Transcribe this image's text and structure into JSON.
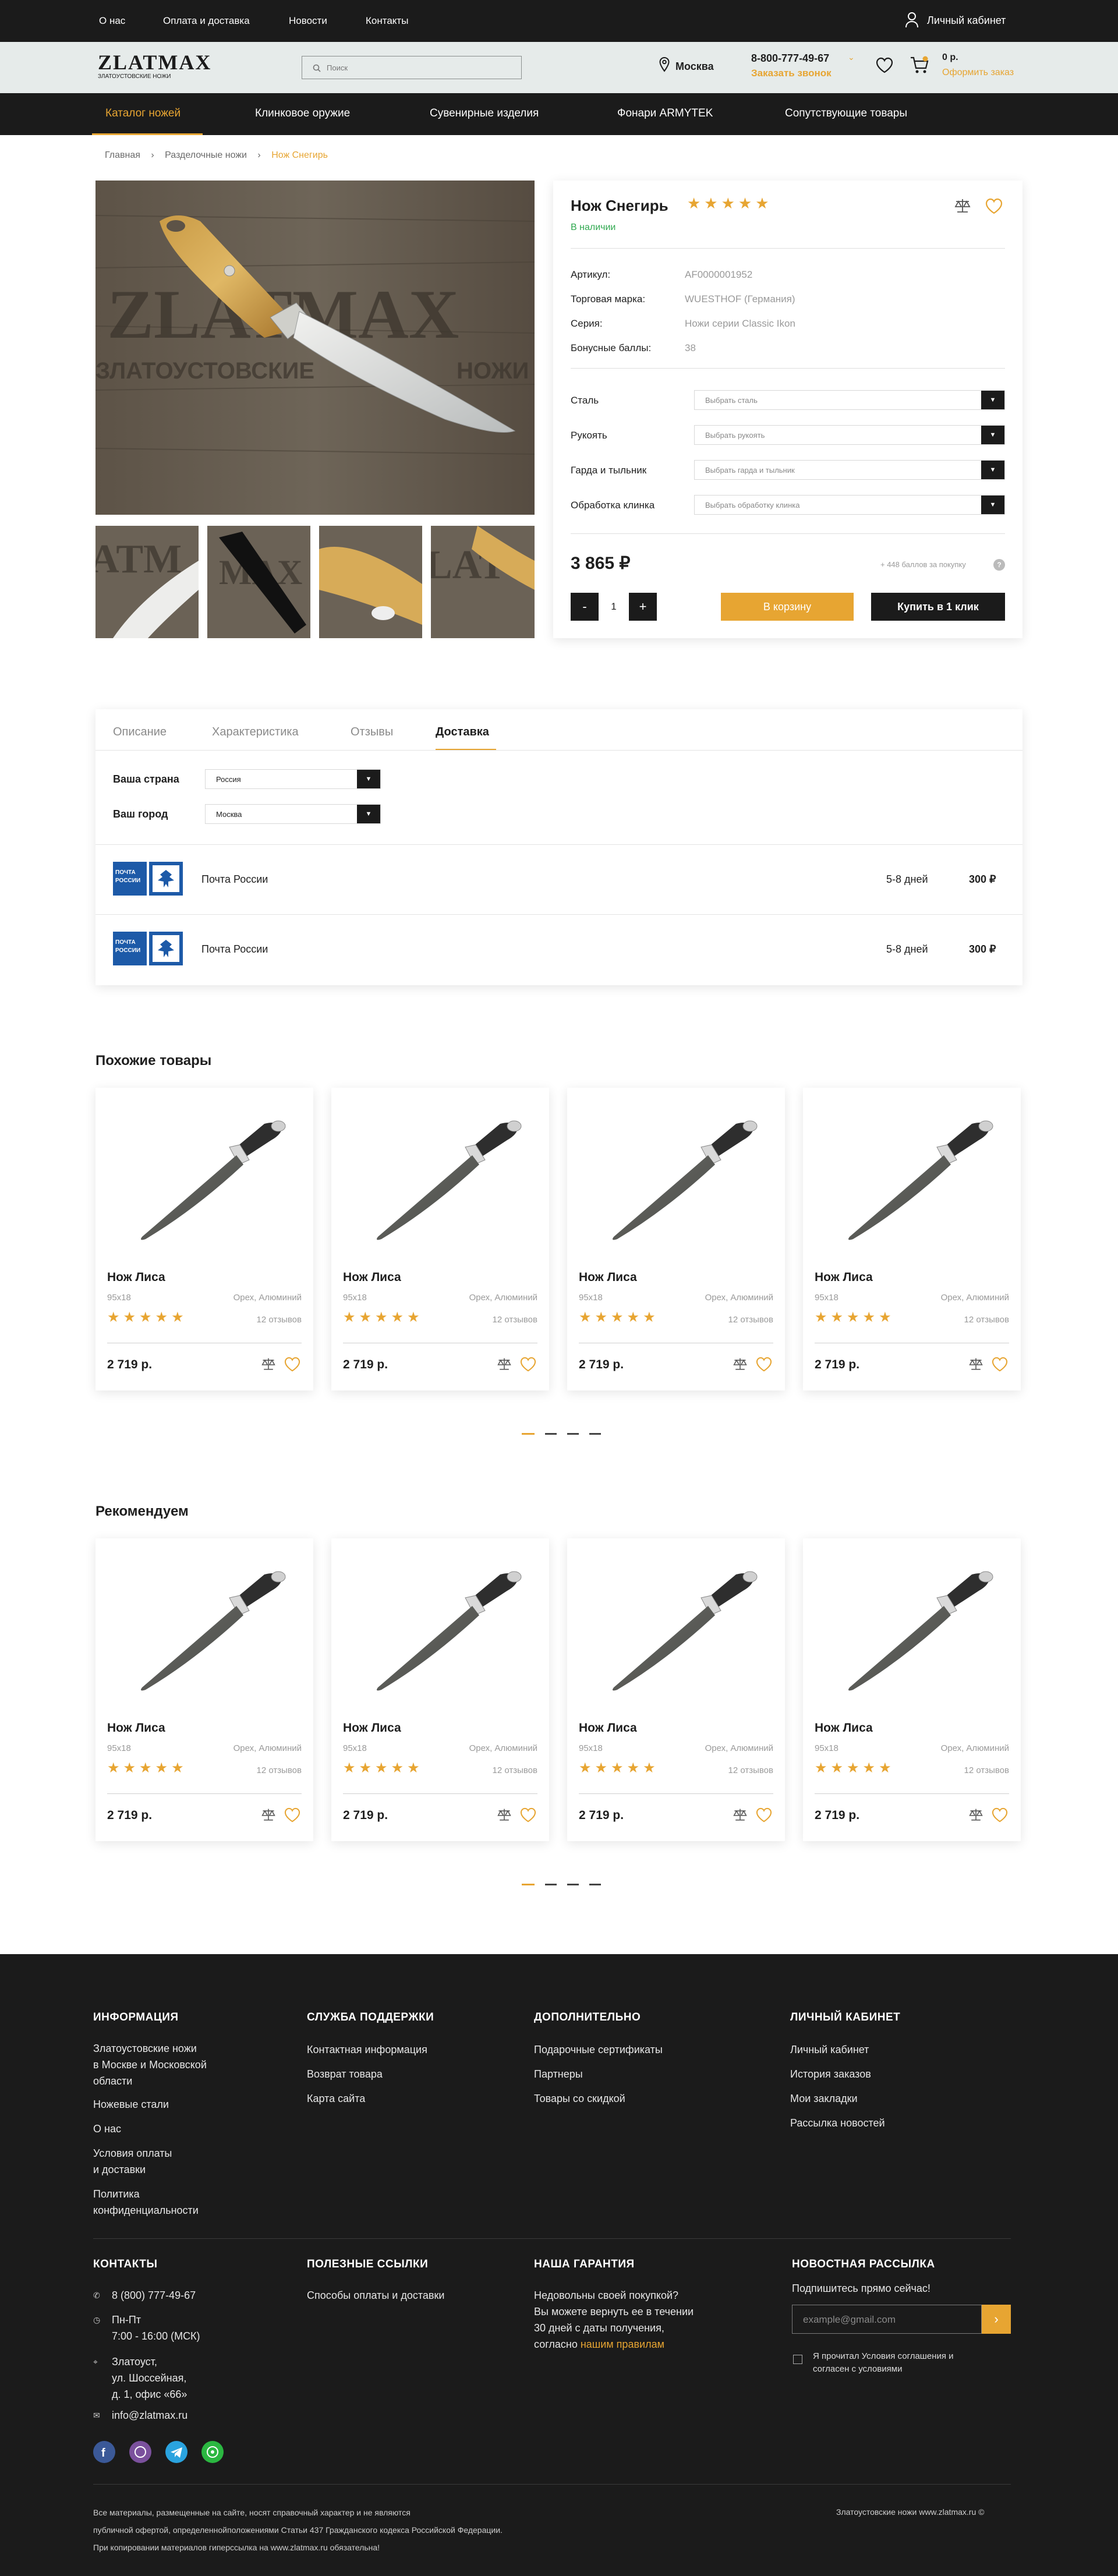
{
  "topbar": {
    "links": [
      "О нас",
      "Оплата и доставка",
      "Новости",
      "Контакты"
    ],
    "account": "Личный кабинет"
  },
  "header": {
    "logo_main": "ZLATMAX",
    "logo_sub": "ЗЛАТОУСТОВСКИЕ НОЖИ",
    "search_placeholder": "Поиск",
    "city": "Москва",
    "phone": "8-800-777-49-67",
    "callback": "Заказать звонок",
    "cart_total": "0 р.",
    "checkout": "Оформить заказ"
  },
  "nav": [
    "Каталог ножей",
    "Клинковое оружие",
    "Сувенирные изделия",
    "Фонари ARMYTEK",
    "Сопутствующие товары"
  ],
  "breadcrumb": [
    "Главная",
    "Разделочные ножи",
    "Нож Снегирь"
  ],
  "product": {
    "title": "Нож Снегирь",
    "stars": "★★★★★",
    "availability": "В наличии",
    "specs": [
      {
        "label": "Артикул:",
        "value": "AF0000001952"
      },
      {
        "label": "Торговая марка:",
        "value": "WUESTHOF (Германия)"
      },
      {
        "label": "Серия:",
        "value": "Ножи серии Classic Ikon"
      },
      {
        "label": "Бонусные баллы:",
        "value": "38"
      }
    ],
    "options": [
      {
        "label": "Сталь",
        "placeholder": "Выбрать сталь"
      },
      {
        "label": "Рукоять",
        "placeholder": "Выбрать рукоять"
      },
      {
        "label": "Гарда и тыльник",
        "placeholder": "Выбрать гарда и тыльник"
      },
      {
        "label": "Обработка клинка",
        "placeholder": "Выбрать обработку клинка"
      }
    ],
    "price": "3 865 ₽",
    "bonus_note": "+ 448 баллов за покупку",
    "quantity": "1",
    "minus": "-",
    "plus": "+",
    "add_to_cart": "В корзину",
    "buy_one_click": "Купить в 1 клик"
  },
  "tabs": {
    "items": [
      "Описание",
      "Характеристика",
      "Отзывы",
      "Доставка"
    ],
    "country_label": "Ваша страна",
    "country_value": "Россия",
    "city_label": "Ваш город",
    "city_value": "Москва",
    "deliveries": [
      {
        "logo": "ПОЧТА РОССИИ",
        "name": "Почта России",
        "days": "5-8 дней",
        "price": "300 ₽"
      },
      {
        "logo": "ПОЧТА РОССИИ",
        "name": "Почта России",
        "days": "5-8 дней",
        "price": "300 ₽"
      }
    ]
  },
  "similar": {
    "title": "Похожие товары",
    "items": [
      {
        "name": "Нож Лиса",
        "size": "95х18",
        "material": "Орех, Алюминий",
        "stars": "★★★★★",
        "reviews": "12 отзывов",
        "price": "2 719 р."
      },
      {
        "name": "Нож Лиса",
        "size": "95х18",
        "material": "Орех, Алюминий",
        "stars": "★★★★★",
        "reviews": "12 отзывов",
        "price": "2 719 р."
      },
      {
        "name": "Нож Лиса",
        "size": "95х18",
        "material": "Орех, Алюминий",
        "stars": "★★★★★",
        "reviews": "12 отзывов",
        "price": "2 719 р."
      },
      {
        "name": "Нож Лиса",
        "size": "95х18",
        "material": "Орех, Алюминий",
        "stars": "★★★★★",
        "reviews": "12 отзывов",
        "price": "2 719 р."
      }
    ]
  },
  "recommend": {
    "title": "Рекомендуем",
    "items": [
      {
        "name": "Нож Лиса",
        "size": "95х18",
        "material": "Орех, Алюминий",
        "stars": "★★★★★",
        "reviews": "12 отзывов",
        "price": "2 719 р."
      },
      {
        "name": "Нож Лиса",
        "size": "95х18",
        "material": "Орех, Алюминий",
        "stars": "★★★★★",
        "reviews": "12 отзывов",
        "price": "2 719 р."
      },
      {
        "name": "Нож Лиса",
        "size": "95х18",
        "material": "Орех, Алюминий",
        "stars": "★★★★★",
        "reviews": "12 отзывов",
        "price": "2 719 р."
      },
      {
        "name": "Нож Лиса",
        "size": "95х18",
        "material": "Орех, Алюминий",
        "stars": "★★★★★",
        "reviews": "12 отзывов",
        "price": "2 719 р."
      }
    ]
  },
  "footer": {
    "col1_title": "ИНФОРМАЦИЯ",
    "col1": [
      "Златоустовские ножи\nв Москве и Московской\nобласти",
      "Ножевые стали",
      "О нас",
      "Условия оплаты\nи доставки",
      "Политика\nконфиденциальности"
    ],
    "col2_title": "СЛУЖБА ПОДДЕРЖКИ",
    "col2": [
      "Контактная информация",
      "Возврат товара",
      "Карта сайта"
    ],
    "col3_title": "ДОПОЛНИТЕЛЬНО",
    "col3": [
      "Подарочные сертификаты",
      "Партнеры",
      "Товары со скидкой"
    ],
    "col4_title": "ЛИЧНЫЙ КАБИНЕТ",
    "col4": [
      "Личный кабинет",
      "История заказов",
      "Мои закладки",
      "Рассылка новостей"
    ],
    "contacts_title": "КОНТАКТЫ",
    "phone": "8 (800) 777-49-67",
    "hours": "Пн-Пт\n7:00 - 16:00 (МСК)",
    "address": "Златоуст,\nул. Шоссейная,\nд. 1, офис «66»",
    "email": "info@zlatmax.ru",
    "useful_title": "ПОЛЕЗНЫЕ ССЫЛКИ",
    "useful": "Способы оплаты и доставки",
    "guarantee_title": "НАША ГАРАНТИЯ",
    "guarantee": "Недовольны своей покупкой?\nВы можете вернуть ее в течении\n30 дней с даты получения,\nсогласно ",
    "guarantee_link": "нашим правилам",
    "news_title": "НОВОСТНАЯ РАССЫЛКА",
    "news_sub": "Подпишитесь прямо сейчас!",
    "email_placeholder": "example@gmail.com",
    "agree": "Я прочитал Условия соглашения и\nсогласен с условиями",
    "legal": "Все материалы, размещенные на сайте, носят справочный характер и не являются\nпубличной офертой, определеннойположениями Статьи 437 Гражданского кодекса Российской Федерации.\nПри копировании материалов гиперссылка на www.zlatmax.ru обязательна!",
    "copyright": "Златоустовские ножи www.zlatmax.ru ©"
  },
  "colors": {
    "accent": "#e7a532",
    "dark": "#1b1b1b",
    "green": "#2fa84f"
  }
}
